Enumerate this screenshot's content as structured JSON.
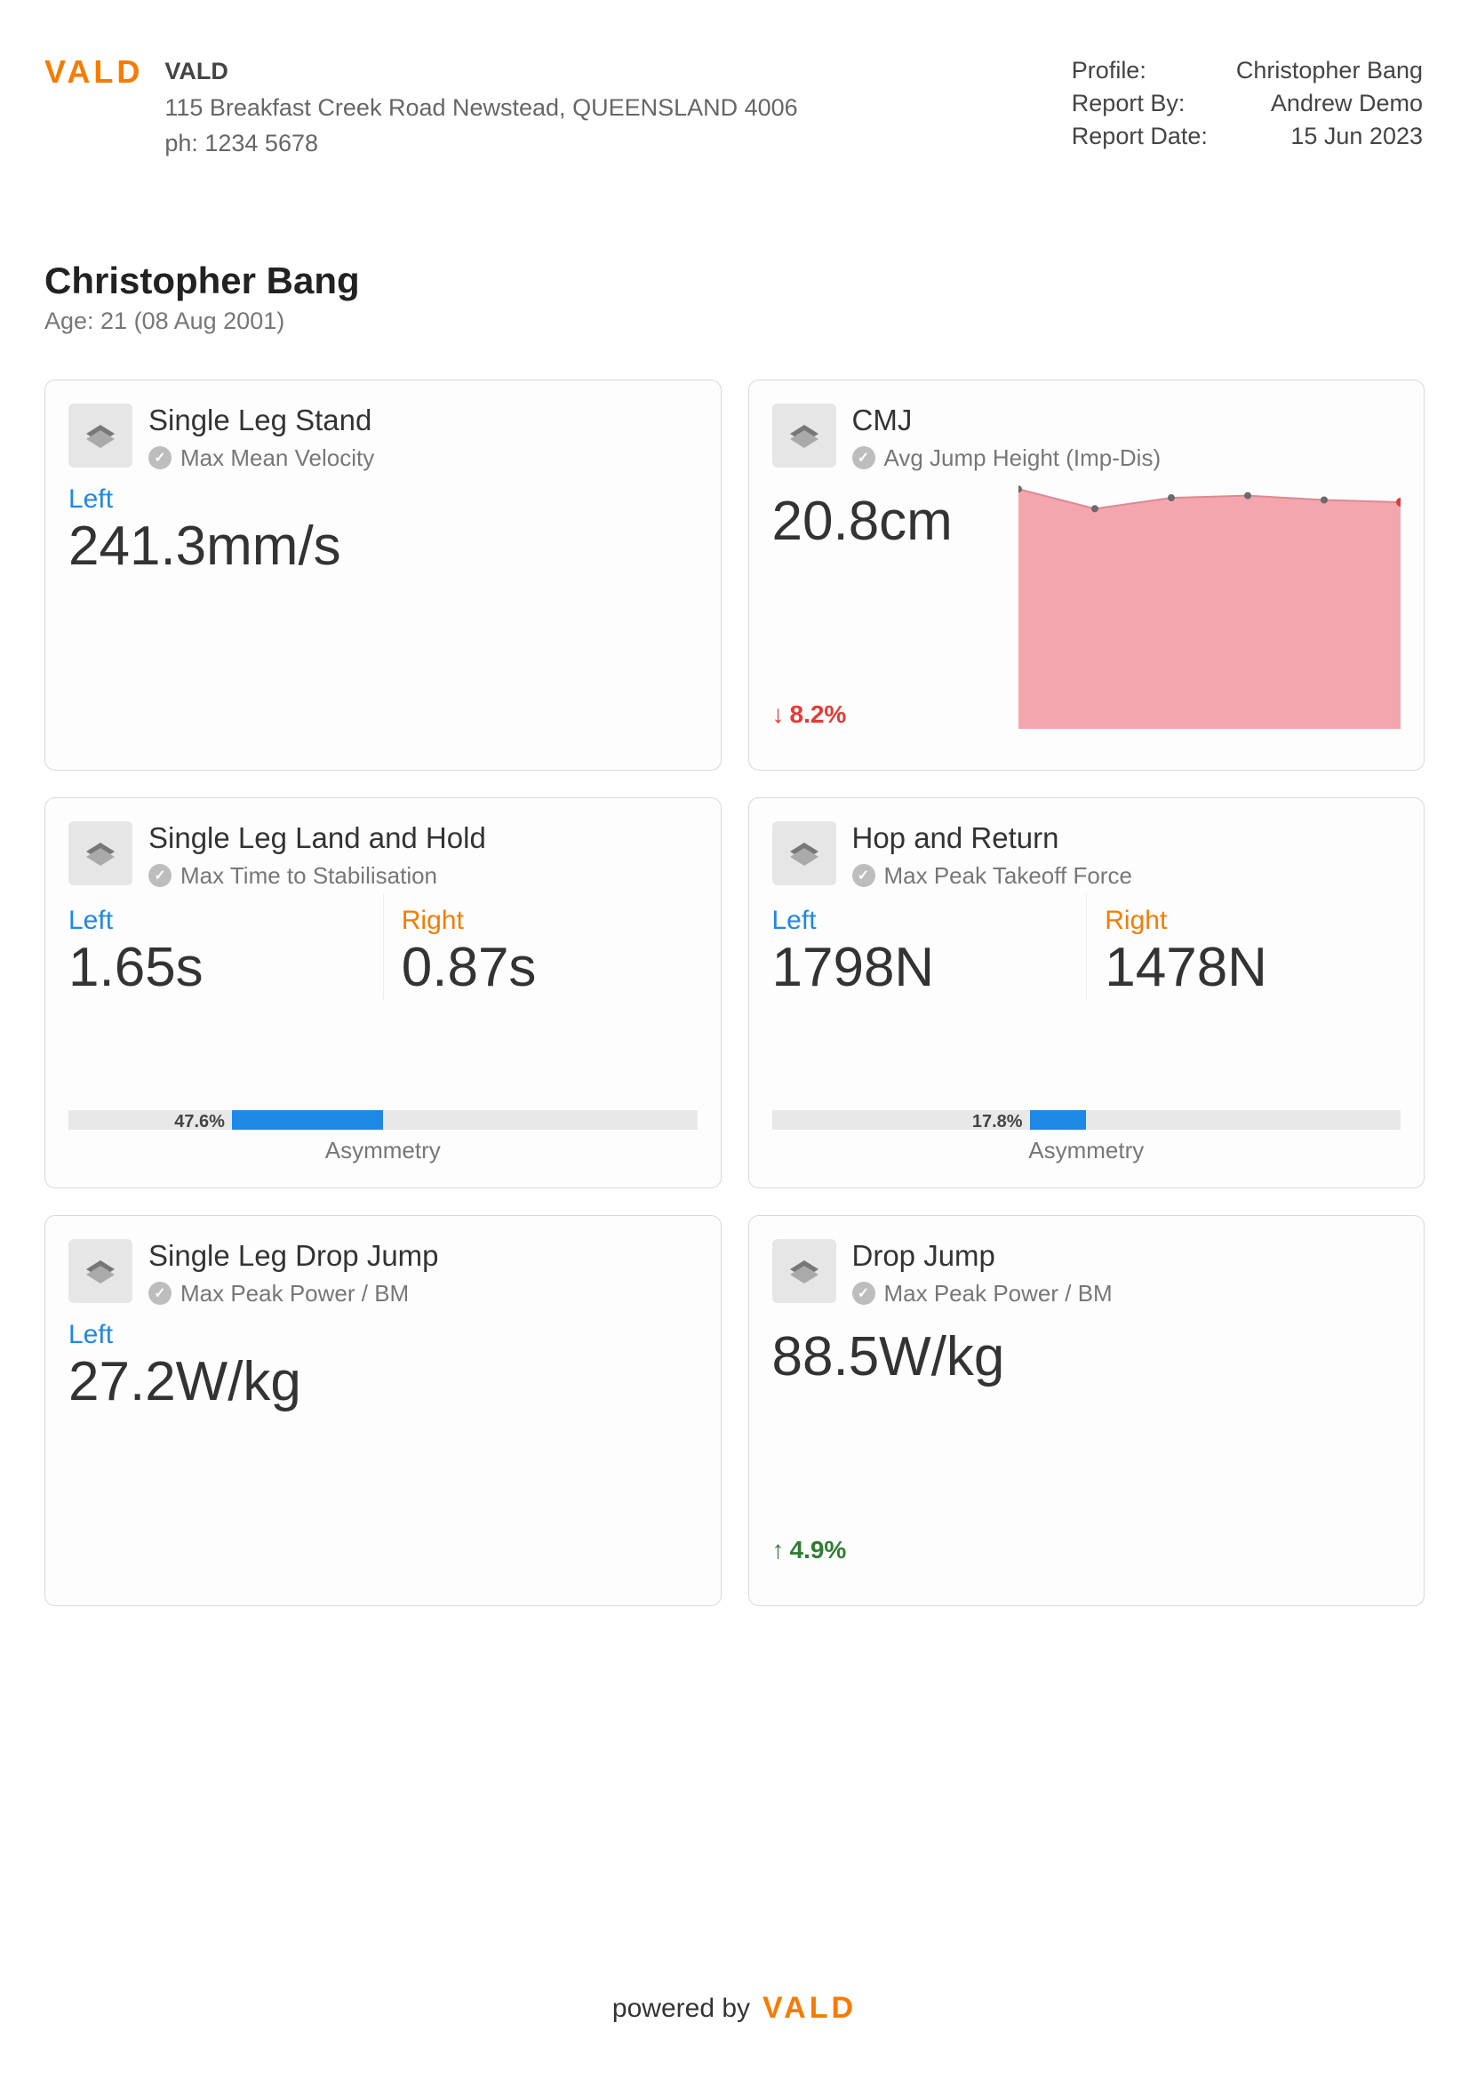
{
  "header": {
    "logo_text": "VALD",
    "org": {
      "name": "VALD",
      "address": "115 Breakfast Creek Road Newstead, QUEENSLAND 4006",
      "phone_label": "ph: 1234 5678"
    },
    "meta": {
      "profile_label": "Profile:",
      "profile_value": "Christopher Bang",
      "reportby_label": "Report By:",
      "reportby_value": "Andrew Demo",
      "reportdate_label": "Report Date:",
      "reportdate_value": "15 Jun 2023"
    }
  },
  "subject": {
    "name": "Christopher Bang",
    "age_line": "Age: 21 (08 Aug 2001)"
  },
  "labels": {
    "left": "Left",
    "right": "Right",
    "asymmetry": "Asymmetry"
  },
  "cards": [
    {
      "title": "Single Leg Stand",
      "metric": "Max Mean Velocity",
      "left_value": "241.3mm/s"
    },
    {
      "title": "CMJ",
      "metric": "Avg Jump Height (Imp-Dis)",
      "value": "20.8cm",
      "trend": {
        "dir": "down",
        "text": "8.2%"
      }
    },
    {
      "title": "Single Leg Land and Hold",
      "metric": "Max Time to Stabilisation",
      "left_value": "1.65s",
      "right_value": "0.87s",
      "asymmetry": {
        "pct_text": "47.6%",
        "fill_center_to_right_pct": 24
      }
    },
    {
      "title": "Hop and Return",
      "metric": "Max Peak Takeoff Force",
      "left_value": "1798N",
      "right_value": "1478N",
      "asymmetry": {
        "pct_text": "17.8%",
        "fill_center_to_right_pct": 9
      }
    },
    {
      "title": "Single Leg Drop Jump",
      "metric": "Max Peak Power / BM",
      "left_value": "27.2W/kg"
    },
    {
      "title": "Drop Jump",
      "metric": "Max Peak Power / BM",
      "value": "88.5W/kg",
      "trend": {
        "dir": "up",
        "text": "4.9%"
      }
    }
  ],
  "chart_data": {
    "type": "area",
    "x": [
      1,
      2,
      3,
      4,
      5,
      6
    ],
    "values": [
      22.0,
      20.2,
      21.2,
      21.4,
      21.0,
      20.8
    ],
    "title": "",
    "xlabel": "",
    "ylabel": "",
    "ylim": [
      0,
      23
    ],
    "highlight_last": true,
    "fill_color": "#f4a6ae",
    "point_color": "#6b6b6b",
    "last_point_color": "#e53935"
  },
  "footer": {
    "prefix": "powered by",
    "logo_text": "VALD"
  }
}
